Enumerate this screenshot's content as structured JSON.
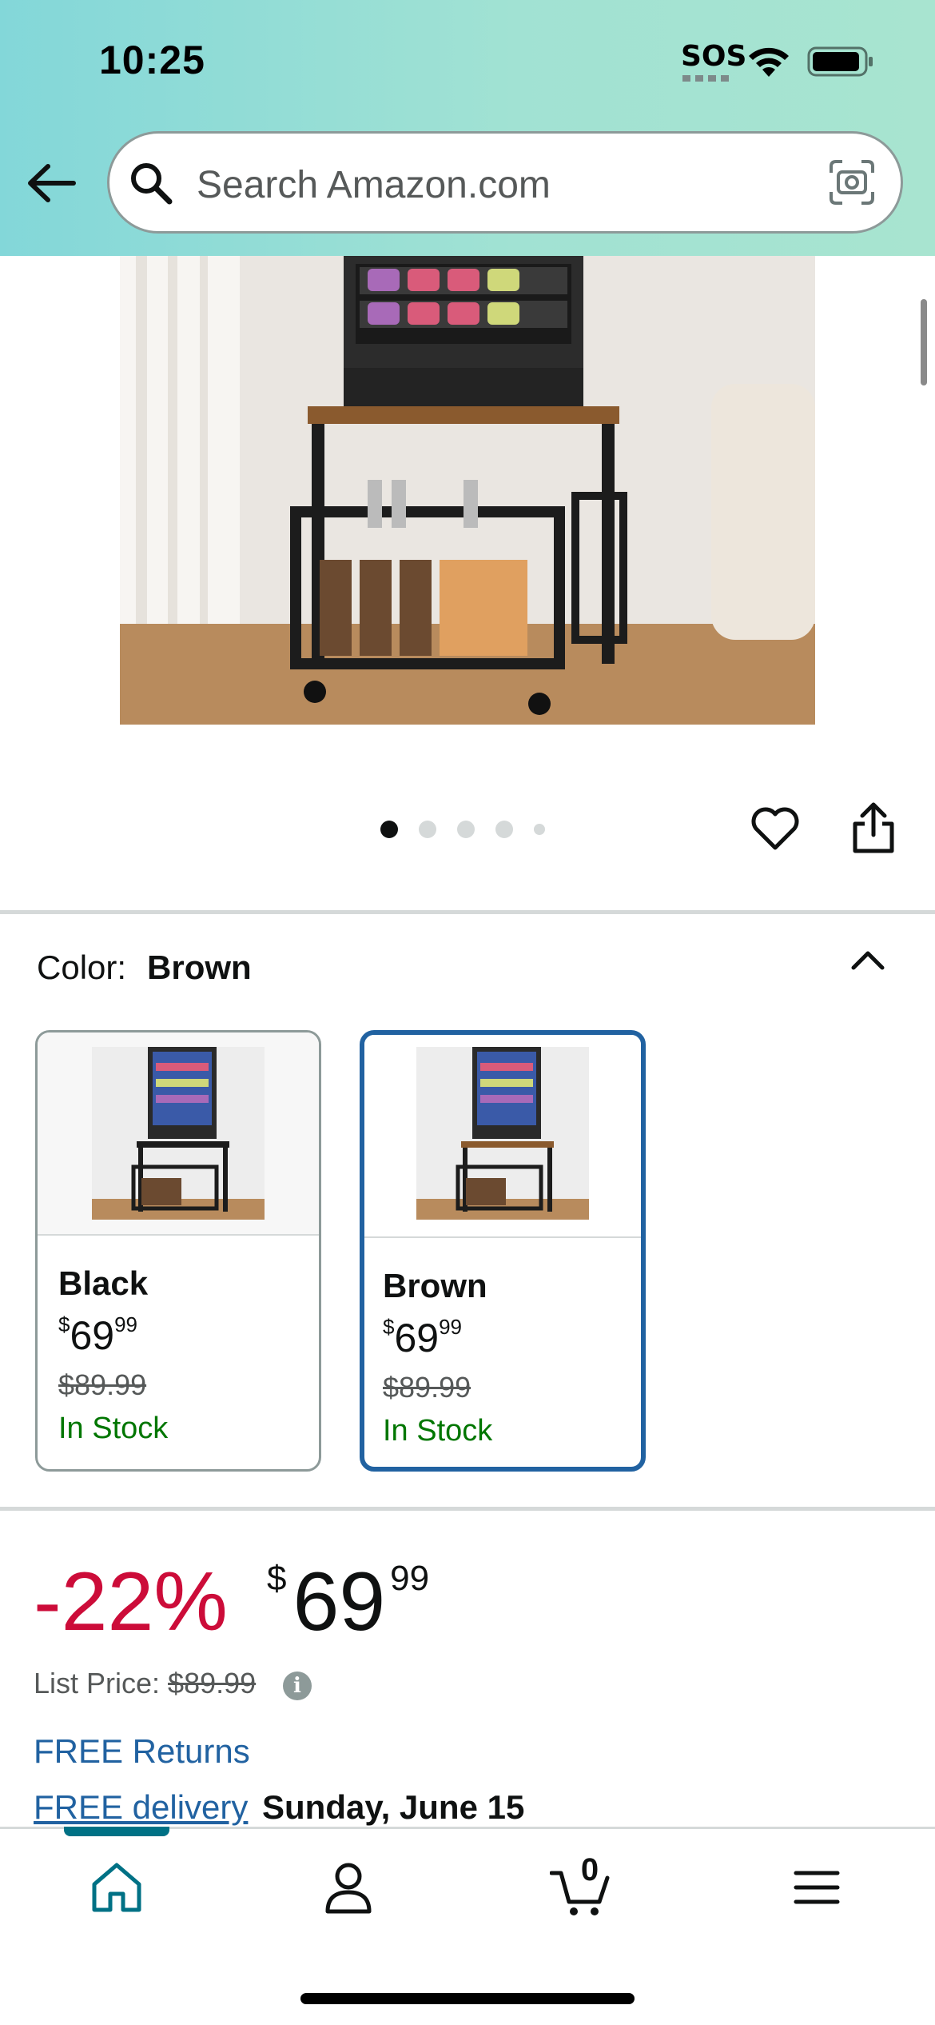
{
  "status_bar": {
    "time": "10:25",
    "sos": "SOS"
  },
  "search": {
    "placeholder": "Search Amazon.com"
  },
  "icons": {
    "back": "back-arrow-icon",
    "search": "search-icon",
    "camera": "camera-lens-icon",
    "wishlist": "heart-icon",
    "share": "share-icon",
    "collapse": "chevron-up-icon",
    "info": "info-icon",
    "home": "home-icon",
    "account": "person-icon",
    "cart": "cart-icon",
    "menu": "hamburger-menu-icon"
  },
  "gallery": {
    "image_count": 5,
    "active_index": 0
  },
  "color_selector": {
    "label": "Color:",
    "selected": "Brown",
    "options": [
      {
        "name": "Black",
        "price_symbol": "$",
        "price_whole": "69",
        "price_fraction": "99",
        "list_price": "$89.99",
        "availability": "In Stock"
      },
      {
        "name": "Brown",
        "price_symbol": "$",
        "price_whole": "69",
        "price_fraction": "99",
        "list_price": "$89.99",
        "availability": "In Stock"
      }
    ]
  },
  "pricing": {
    "discount": "-22%",
    "symbol": "$",
    "whole": "69",
    "fraction": "99",
    "list_label": "List Price:",
    "list_price": "$89.99"
  },
  "shipping": {
    "returns": "FREE Returns",
    "delivery_link": "FREE delivery",
    "delivery_date": "Sunday, June 15"
  },
  "bottom_nav": {
    "cart_count": "0",
    "active_tab": "home"
  },
  "colors": {
    "accent_teal": "#007185",
    "link_blue": "#2162a1",
    "discount_red": "#cc0c39",
    "stock_green": "#007600"
  }
}
